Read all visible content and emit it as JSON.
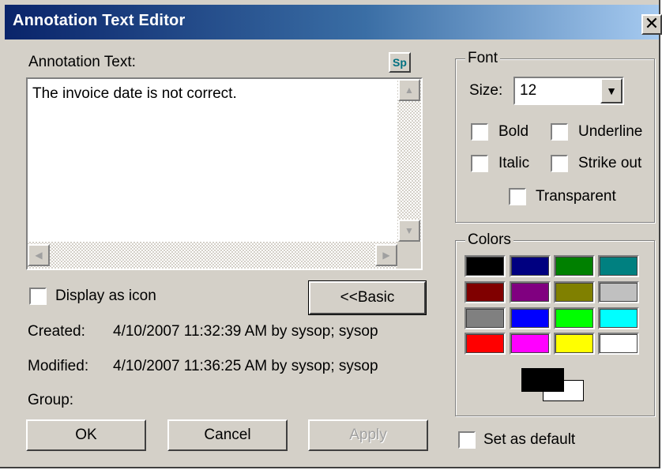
{
  "window": {
    "title": "Annotation Text Editor",
    "close_glyph": "✕"
  },
  "annotation": {
    "label": "Annotation Text:",
    "spell_button": "Sp",
    "text": "The invoice date is not correct."
  },
  "display_as_icon": {
    "label": "Display as icon",
    "checked": false
  },
  "basic_button": "<<Basic",
  "info": {
    "created_label": "Created:",
    "created_value": "4/10/2007 11:32:39 AM by sysop; sysop",
    "modified_label": "Modified:",
    "modified_value": "4/10/2007 11:36:25 AM by sysop; sysop",
    "group_label": "Group:"
  },
  "buttons": {
    "ok": "OK",
    "cancel": "Cancel",
    "apply": "Apply"
  },
  "font": {
    "title": "Font",
    "size_label": "Size:",
    "size_value": "12",
    "bold": "Bold",
    "underline": "Underline",
    "italic": "Italic",
    "strike_out": "Strike out",
    "transparent": "Transparent"
  },
  "colors": {
    "title": "Colors",
    "palette": [
      "#000000",
      "#000080",
      "#008000",
      "#008080",
      "#800000",
      "#800080",
      "#808000",
      "#c0c0c0",
      "#808080",
      "#0000ff",
      "#00ff00",
      "#00ffff",
      "#ff0000",
      "#ff00ff",
      "#ffff00",
      "#ffffff"
    ],
    "foreground": "#000000",
    "background": "#ffffff"
  },
  "set_as_default": {
    "label": "Set as default",
    "checked": false
  }
}
